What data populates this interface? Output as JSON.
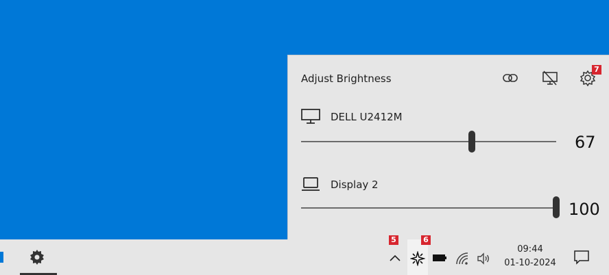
{
  "flyout": {
    "title": "Adjust Brightness",
    "header_icons": [
      "link-icon",
      "display-off-icon",
      "gear-icon"
    ],
    "settings_badge": "7",
    "monitors": [
      {
        "name": "DELL U2412M",
        "icon": "monitor-icon",
        "brightness": 67,
        "brightness_label": "67"
      },
      {
        "name": "Display 2",
        "icon": "laptop-icon",
        "brightness": 100,
        "brightness_label": "100"
      }
    ]
  },
  "taskbar": {
    "tray_badges": {
      "overflow": "5",
      "twinkle_tray": "6"
    },
    "clock": {
      "time": "09:44",
      "date": "01-10-2024"
    },
    "colors": {
      "accent": "#0078D7",
      "badge": "#d7262f",
      "panel": "#e6e6e6"
    }
  }
}
